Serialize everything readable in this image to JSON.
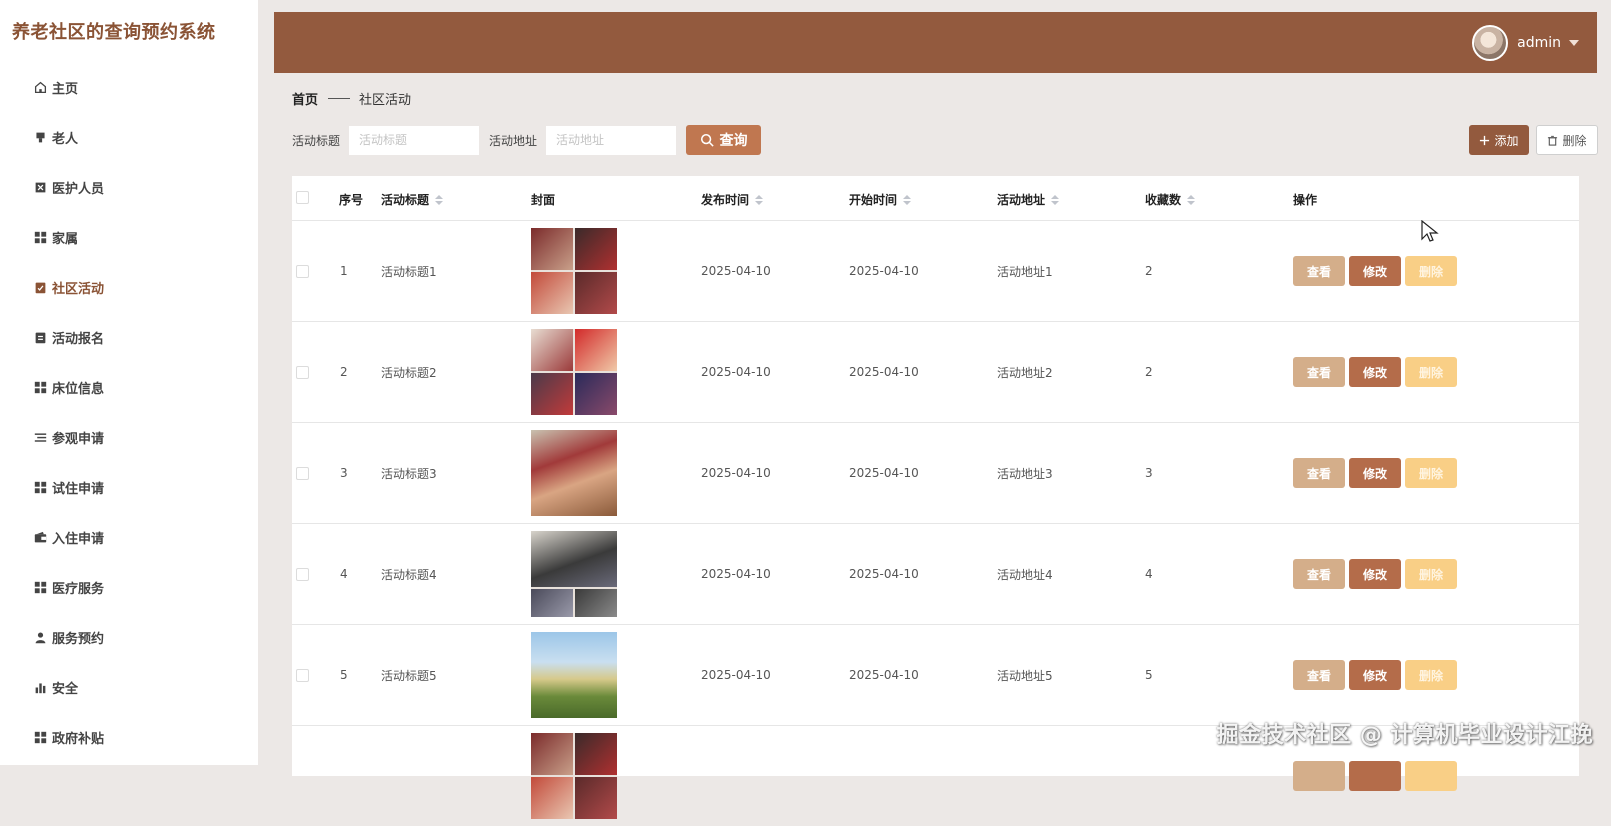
{
  "app": {
    "title": "养老社区的查询预约系统"
  },
  "sidebar": {
    "items": [
      {
        "label": "主页",
        "icon": "home-icon"
      },
      {
        "label": "老人",
        "icon": "elder-icon"
      },
      {
        "label": "医护人员",
        "icon": "medical-staff-icon"
      },
      {
        "label": "家属",
        "icon": "grid-icon"
      },
      {
        "label": "社区活动",
        "icon": "clipboard-check-icon",
        "active": true
      },
      {
        "label": "活动报名",
        "icon": "clipboard-icon"
      },
      {
        "label": "床位信息",
        "icon": "grid-icon"
      },
      {
        "label": "参观申请",
        "icon": "list-icon"
      },
      {
        "label": "试住申请",
        "icon": "grid-icon"
      },
      {
        "label": "入住申请",
        "icon": "wallet-icon"
      },
      {
        "label": "医疗服务",
        "icon": "grid-icon"
      },
      {
        "label": "服务预约",
        "icon": "user-icon"
      },
      {
        "label": "安全",
        "icon": "bar-chart-icon"
      },
      {
        "label": "政府补贴",
        "icon": "grid-icon"
      }
    ]
  },
  "header": {
    "username": "admin",
    "accent": "#935a3e"
  },
  "breadcrumb": {
    "home": "首页",
    "current": "社区活动"
  },
  "search": {
    "title_label": "活动标题",
    "title_placeholder": "活动标题",
    "address_label": "活动地址",
    "address_placeholder": "活动地址",
    "query_button": "查询"
  },
  "toolbar": {
    "add_label": "添加",
    "delete_label": "删除"
  },
  "table": {
    "columns": [
      "序号",
      "活动标题",
      "封面",
      "发布时间",
      "开始时间",
      "活动地址",
      "收藏数",
      "操作"
    ],
    "actions": {
      "view": "查看",
      "edit": "修改",
      "delete": "删除"
    },
    "rows": [
      {
        "index": "1",
        "title": "活动标题1",
        "publish": "2025-04-10",
        "start": "2025-04-10",
        "address": "活动地址1",
        "favorites": "2"
      },
      {
        "index": "2",
        "title": "活动标题2",
        "publish": "2025-04-10",
        "start": "2025-04-10",
        "address": "活动地址2",
        "favorites": "2"
      },
      {
        "index": "3",
        "title": "活动标题3",
        "publish": "2025-04-10",
        "start": "2025-04-10",
        "address": "活动地址3",
        "favorites": "3"
      },
      {
        "index": "4",
        "title": "活动标题4",
        "publish": "2025-04-10",
        "start": "2025-04-10",
        "address": "活动地址4",
        "favorites": "4"
      },
      {
        "index": "5",
        "title": "活动标题5",
        "publish": "2025-04-10",
        "start": "2025-04-10",
        "address": "活动地址5",
        "favorites": "5"
      }
    ]
  },
  "watermark": "掘金技术社区 @ 计算机毕业设计江挽"
}
